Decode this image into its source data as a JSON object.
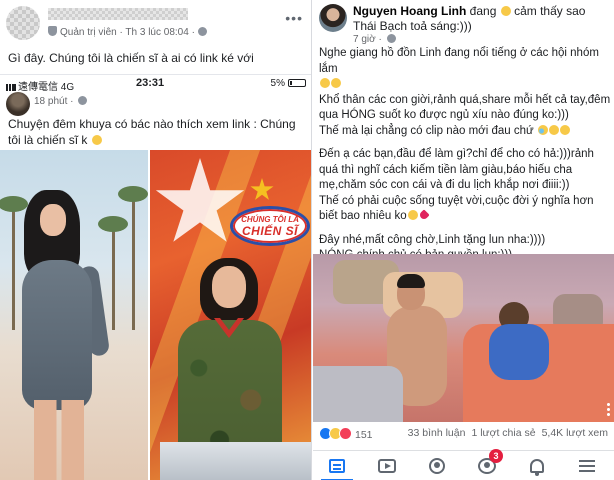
{
  "left_post": {
    "header": {
      "privacy_label": "Quản trị viên",
      "time": "Th 3 lúc 08:04",
      "more_glyph": "•••"
    },
    "caption": "Gì đây. Chúng tôi là chiến sĩ à ai có link ké với",
    "phone_status": {
      "carrier": "遠傳電信",
      "network": "4G",
      "time": "23:31",
      "battery": "5%"
    },
    "inner_post": {
      "time": "18 phút",
      "caption": "Chuyện đêm khuya có bác nào thích xem link : Chúng tôi là chiến sĩ k"
    },
    "photos": {
      "show_logo_line1": "CHÚNG TÔI LÀ",
      "show_logo_line2": "CHIẾN SĨ"
    }
  },
  "right_post": {
    "author": "Nguyen Hoang Linh",
    "status_text": "đang",
    "status_rest": "cảm thấy sao Thái Bạch toả sáng:)))",
    "time": "7 giờ",
    "body": [
      "Nghe giang hồ đồn Linh đang nổi tiếng ở các hội nhóm lắm",
      "Khổ thân các con giời,rảnh quá,share mỗi hết cả tay,đêm qua HÓNG suốt ko được ngủ xíu nào đúng ko:)))",
      "Thế mà lại chẳng có clip nào mới đau chứ",
      "",
      "Đến ạ các bạn,đầu để làm gì?chỉ để cho có hả:)))rảnh quá thì nghĩ cách kiếm tiền làm giàu,báo hiếu cha mẹ,chăm sóc con cái và đi du lịch khắp nơi điiii:))",
      "Thế có phải cuộc sống tuyệt vời,cuộc đời ý nghĩa hơn biết bao nhiêu ko",
      "",
      "Đây nhé,mất công chờ,Linh tặng lun nha:))))",
      "NÓNG chính chủ có bản quyền lun:)))"
    ],
    "stats": {
      "reaction_count": "151",
      "comments": "33 bình luận",
      "shares": "1 lượt chia sẻ",
      "views": "5,4K lượt xem"
    },
    "nav": {
      "groups_badge": "3"
    }
  }
}
